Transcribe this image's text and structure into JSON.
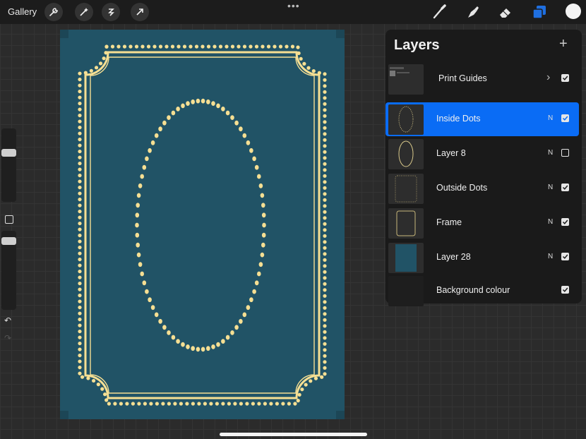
{
  "topbar": {
    "gallery_label": "Gallery",
    "menu_dots": "•••",
    "active_color": "#f4f4f4"
  },
  "canvas": {
    "background": "#215366",
    "ornament_color": "#f6df93"
  },
  "layers": {
    "title": "Layers",
    "add_label": "+",
    "items": [
      {
        "name": "Print Guides",
        "blend": "",
        "visible": true,
        "group": true,
        "active": false
      },
      {
        "name": "Inside Dots",
        "blend": "N",
        "visible": true,
        "group": false,
        "active": true
      },
      {
        "name": "Layer 8",
        "blend": "N",
        "visible": false,
        "group": false,
        "active": false
      },
      {
        "name": "Outside Dots",
        "blend": "N",
        "visible": true,
        "group": false,
        "active": false
      },
      {
        "name": "Frame",
        "blend": "N",
        "visible": true,
        "group": false,
        "active": false
      },
      {
        "name": "Layer 28",
        "blend": "N",
        "visible": true,
        "group": false,
        "active": false
      },
      {
        "name": "Background colour",
        "blend": "",
        "visible": true,
        "group": false,
        "active": false
      }
    ]
  }
}
